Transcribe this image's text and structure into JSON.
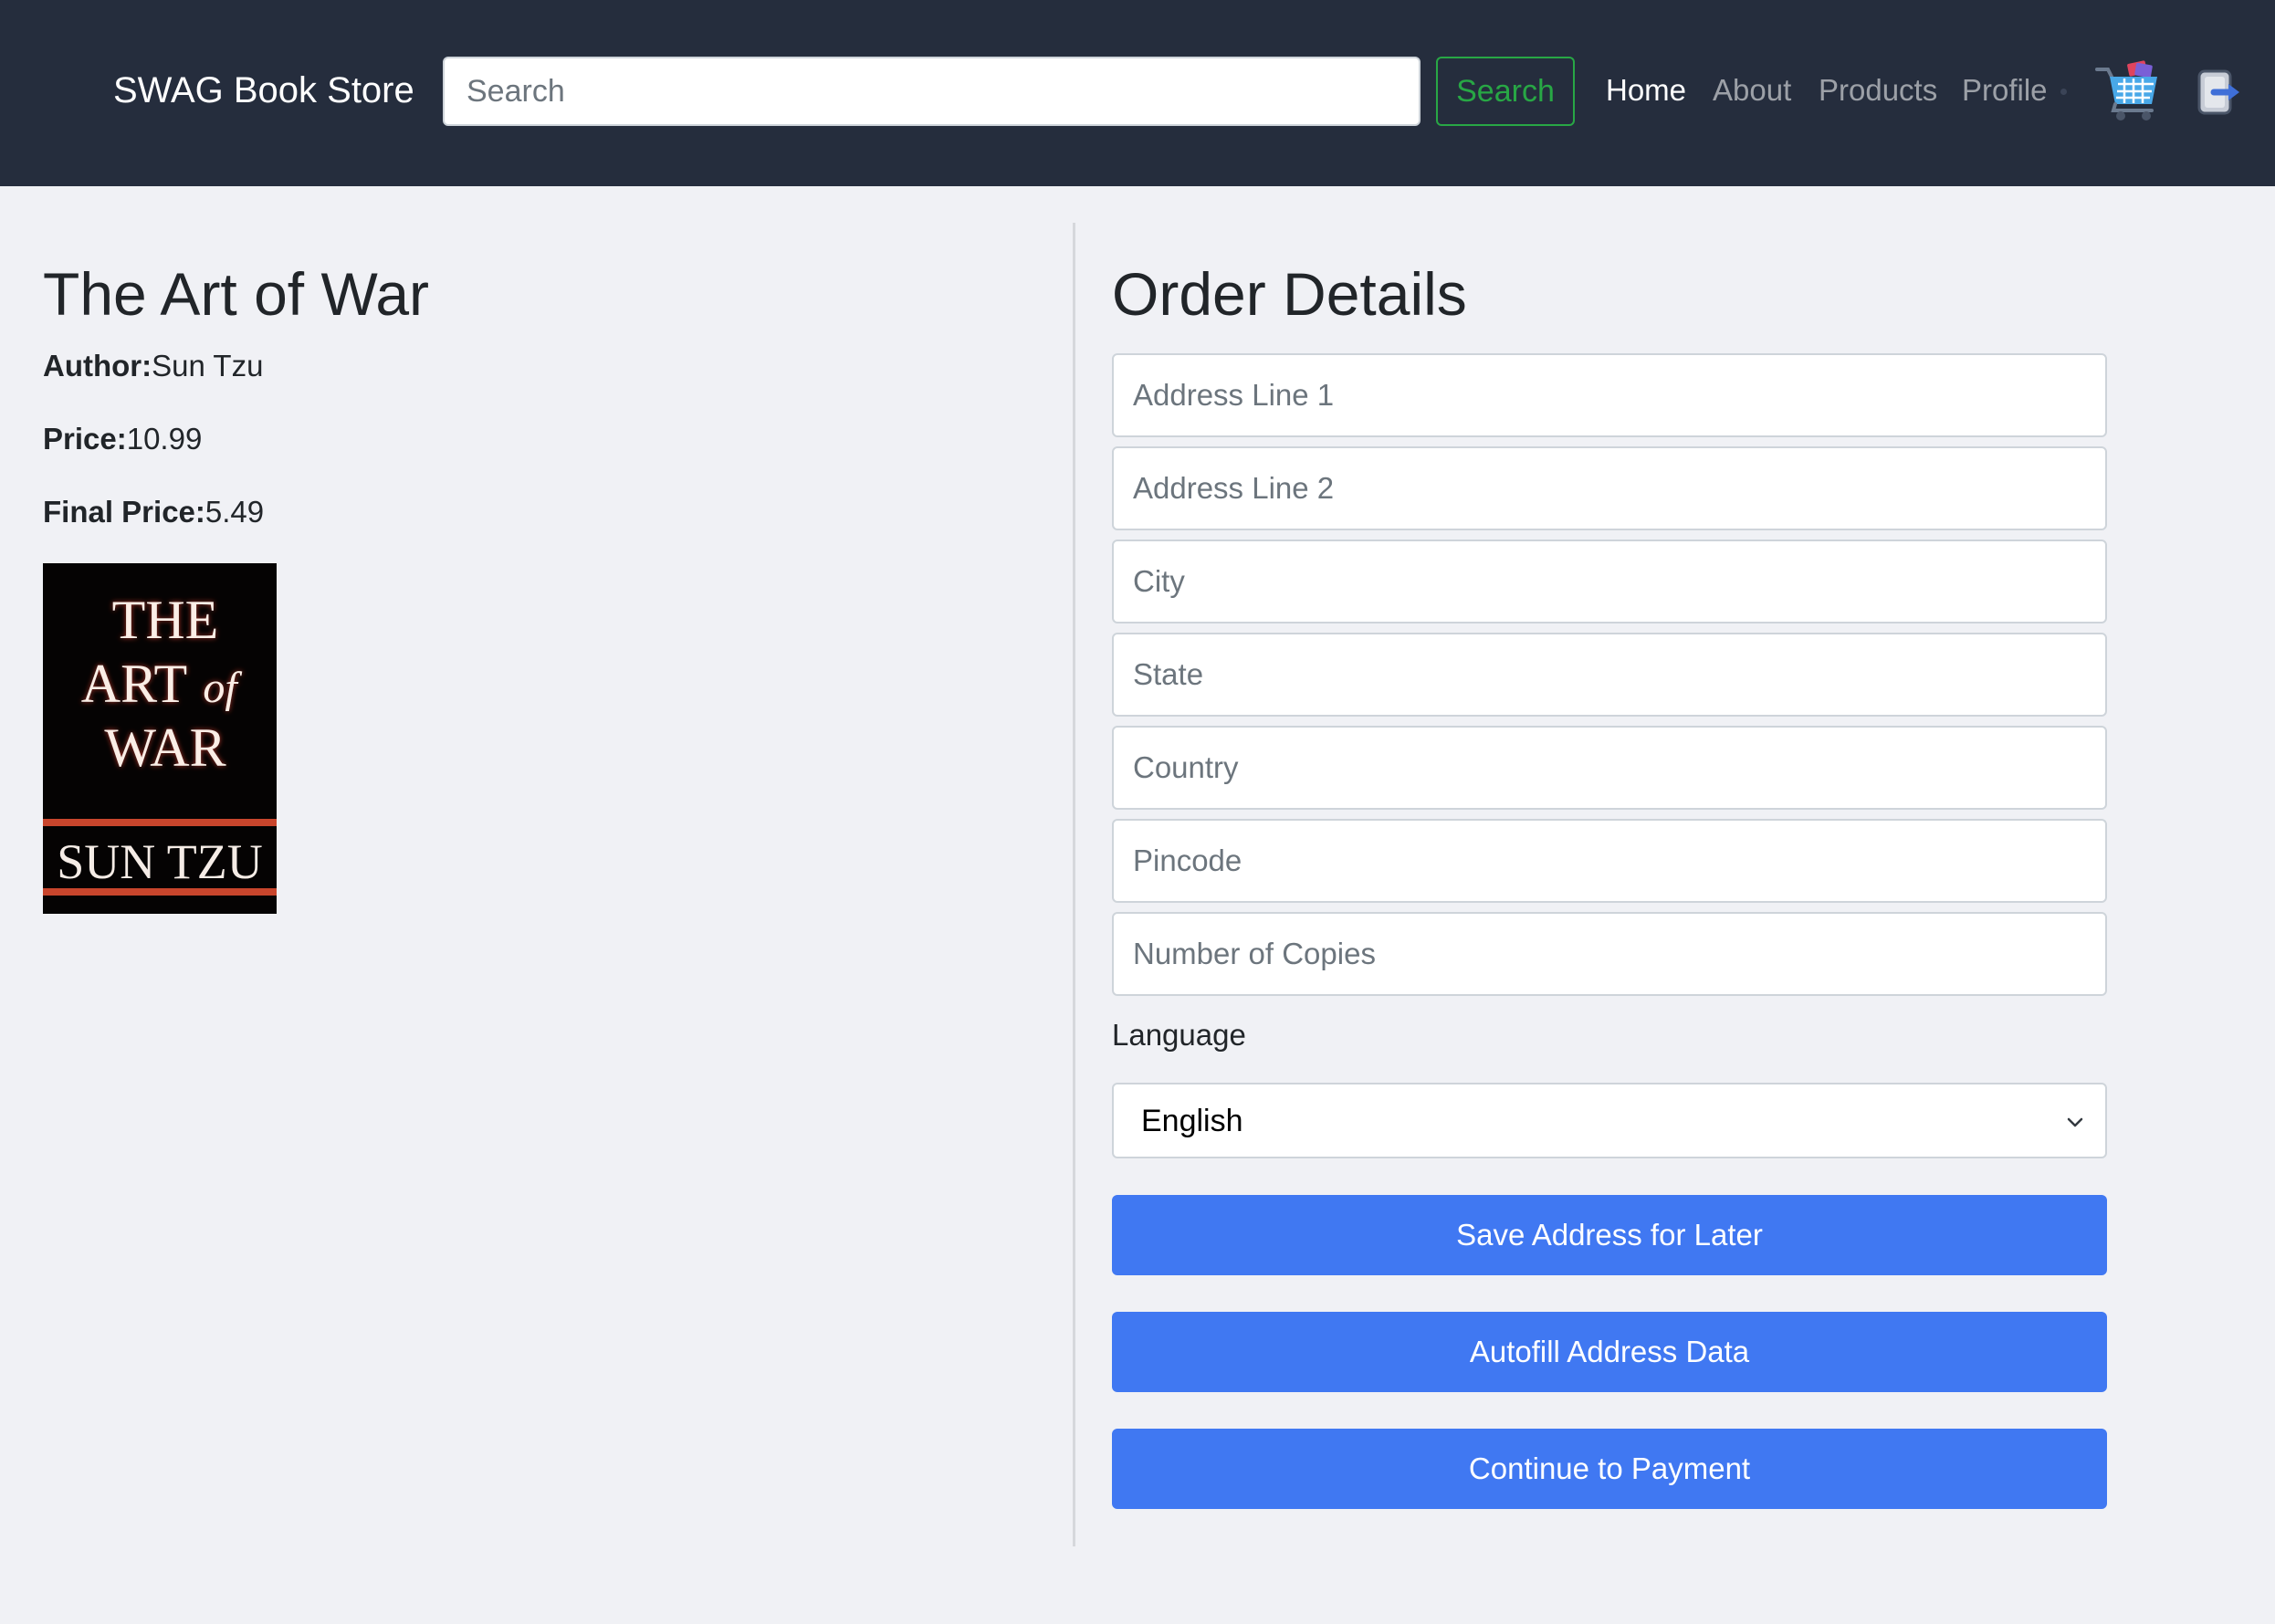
{
  "navbar": {
    "brand": "SWAG Book Store",
    "search_placeholder": "Search",
    "search_button": "Search",
    "links": [
      {
        "label": "Home",
        "active": true
      },
      {
        "label": "About",
        "active": false
      },
      {
        "label": "Products",
        "active": false
      },
      {
        "label": "Profile",
        "active": false
      }
    ],
    "cart_icon": "cart-icon",
    "logout_icon": "logout-icon"
  },
  "book": {
    "title": "The Art of War",
    "author_label": "Author:",
    "author": "Sun Tzu",
    "price_label": "Price:",
    "price": "10.99",
    "final_price_label": "Final Price:",
    "final_price": "5.49",
    "cover": {
      "title_lines": [
        "THE",
        "ART",
        "of",
        "WAR"
      ],
      "author": "SUN TZU"
    }
  },
  "order": {
    "title": "Order Details",
    "fields": {
      "address1": {
        "placeholder": "Address Line 1",
        "value": ""
      },
      "address2": {
        "placeholder": "Address Line 2",
        "value": ""
      },
      "city": {
        "placeholder": "City",
        "value": ""
      },
      "state": {
        "placeholder": "State",
        "value": ""
      },
      "country": {
        "placeholder": "Country",
        "value": ""
      },
      "pincode": {
        "placeholder": "Pincode",
        "value": ""
      },
      "copies": {
        "placeholder": "Number of Copies",
        "value": ""
      }
    },
    "language_label": "Language",
    "language_selected": "English",
    "buttons": {
      "save": "Save Address for Later",
      "autofill": "Autofill Address Data",
      "continue": "Continue to Payment"
    }
  },
  "colors": {
    "navbar_bg": "#252d3d",
    "page_bg": "#f0f1f5",
    "primary": "#4078f2",
    "success": "#28a745"
  }
}
